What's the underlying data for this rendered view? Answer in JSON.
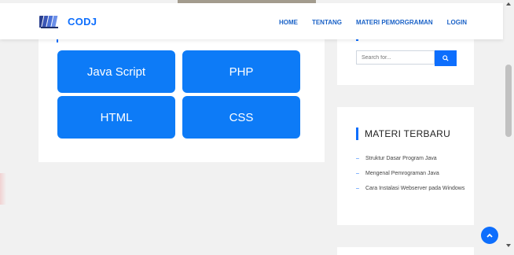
{
  "brand": {
    "name": "CODJ"
  },
  "nav": {
    "items": [
      "HOME",
      "TENTANG",
      "MATERI PEMORGRAMAN",
      "LOGIN"
    ]
  },
  "tiles": [
    "Java Script",
    "PHP",
    "HTML",
    "CSS"
  ],
  "search": {
    "placeholder": "Search for..."
  },
  "sidebar": {
    "title": "MATERI TERBARU",
    "items": [
      "Struktur Dasar Program Java",
      "Mengenal Pemrograman Java",
      "Cara Instalasi Webserver pada Windows"
    ]
  },
  "colors": {
    "accent": "#0d6efd",
    "tile": "#0d7bf7",
    "background": "#f1f1f1"
  },
  "icons": {
    "logo": "book-stack-logo-icon",
    "search": "search-icon",
    "totop": "chevron-up-icon"
  }
}
